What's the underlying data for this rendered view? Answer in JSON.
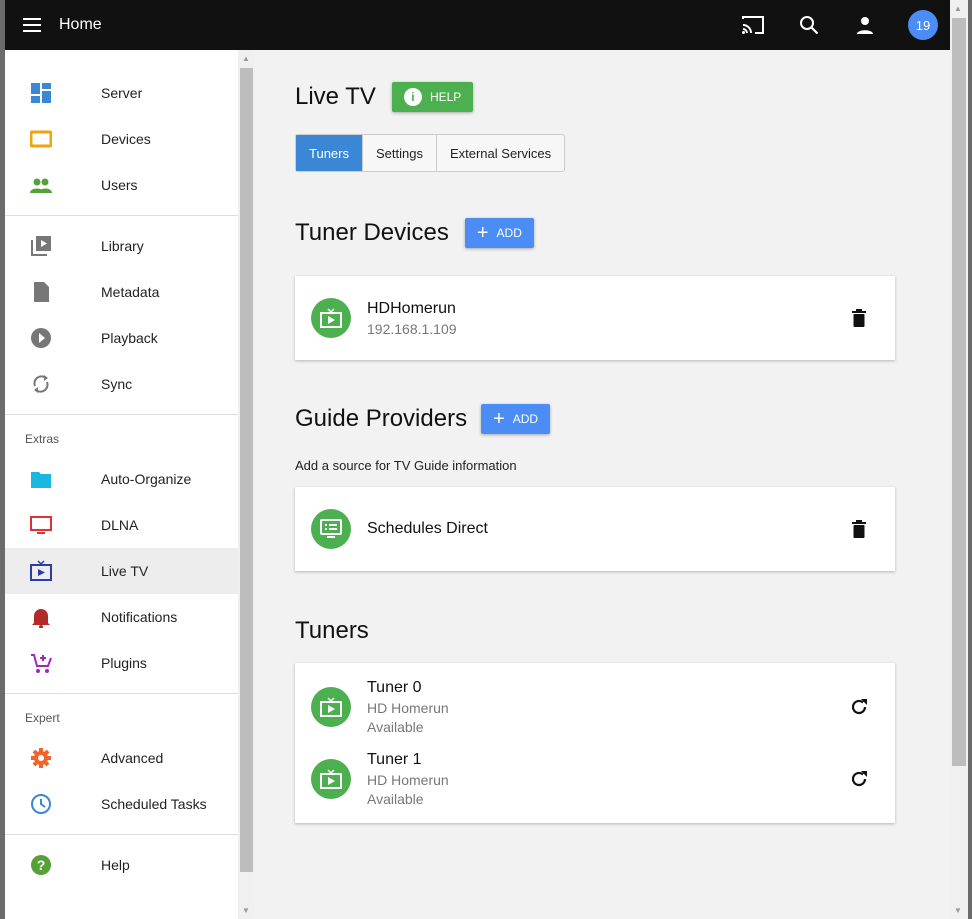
{
  "header": {
    "title": "Home",
    "notification_count": "19"
  },
  "sidebar": {
    "items": [
      {
        "label": "Server",
        "icon": "dashboard-icon",
        "color": "#3a87d6"
      },
      {
        "label": "Devices",
        "icon": "tablet-icon",
        "color": "#f0a30a"
      },
      {
        "label": "Users",
        "icon": "people-icon",
        "color": "#56a03a"
      },
      {
        "label": "Library",
        "icon": "video-library-icon",
        "color": "#777"
      },
      {
        "label": "Metadata",
        "icon": "file-icon",
        "color": "#777"
      },
      {
        "label": "Playback",
        "icon": "play-circle-icon",
        "color": "#777"
      },
      {
        "label": "Sync",
        "icon": "sync-icon",
        "color": "#777"
      },
      {
        "label": "Auto-Organize",
        "icon": "folder-icon",
        "color": "#1ab8e0"
      },
      {
        "label": "DLNA",
        "icon": "monitor-icon",
        "color": "#e03232"
      },
      {
        "label": "Live TV",
        "icon": "live-tv-icon",
        "color": "#2e3ba8"
      },
      {
        "label": "Notifications",
        "icon": "bell-icon",
        "color": "#b22a2a"
      },
      {
        "label": "Plugins",
        "icon": "cart-icon",
        "color": "#a02ab5"
      },
      {
        "label": "Advanced",
        "icon": "gear-icon",
        "color": "#f0642a"
      },
      {
        "label": "Scheduled Tasks",
        "icon": "clock-icon",
        "color": "#3a87d6"
      },
      {
        "label": "Help",
        "icon": "help-icon",
        "color": "#56a03a"
      }
    ],
    "extras_heading": "Extras",
    "expert_heading": "Expert"
  },
  "main": {
    "title": "Live TV",
    "help_label": "HELP",
    "tabs": [
      "Tuners",
      "Settings",
      "External Services"
    ],
    "tuner_devices": {
      "heading": "Tuner Devices",
      "add_label": "ADD",
      "items": [
        {
          "name": "HDHomerun",
          "address": "192.168.1.109"
        }
      ]
    },
    "guide_providers": {
      "heading": "Guide Providers",
      "add_label": "ADD",
      "description": "Add a source for TV Guide information",
      "items": [
        {
          "name": "Schedules Direct"
        }
      ]
    },
    "tuners": {
      "heading": "Tuners",
      "items": [
        {
          "name": "Tuner 0",
          "device": "HD Homerun",
          "status": "Available"
        },
        {
          "name": "Tuner 1",
          "device": "HD Homerun",
          "status": "Available"
        }
      ]
    }
  }
}
